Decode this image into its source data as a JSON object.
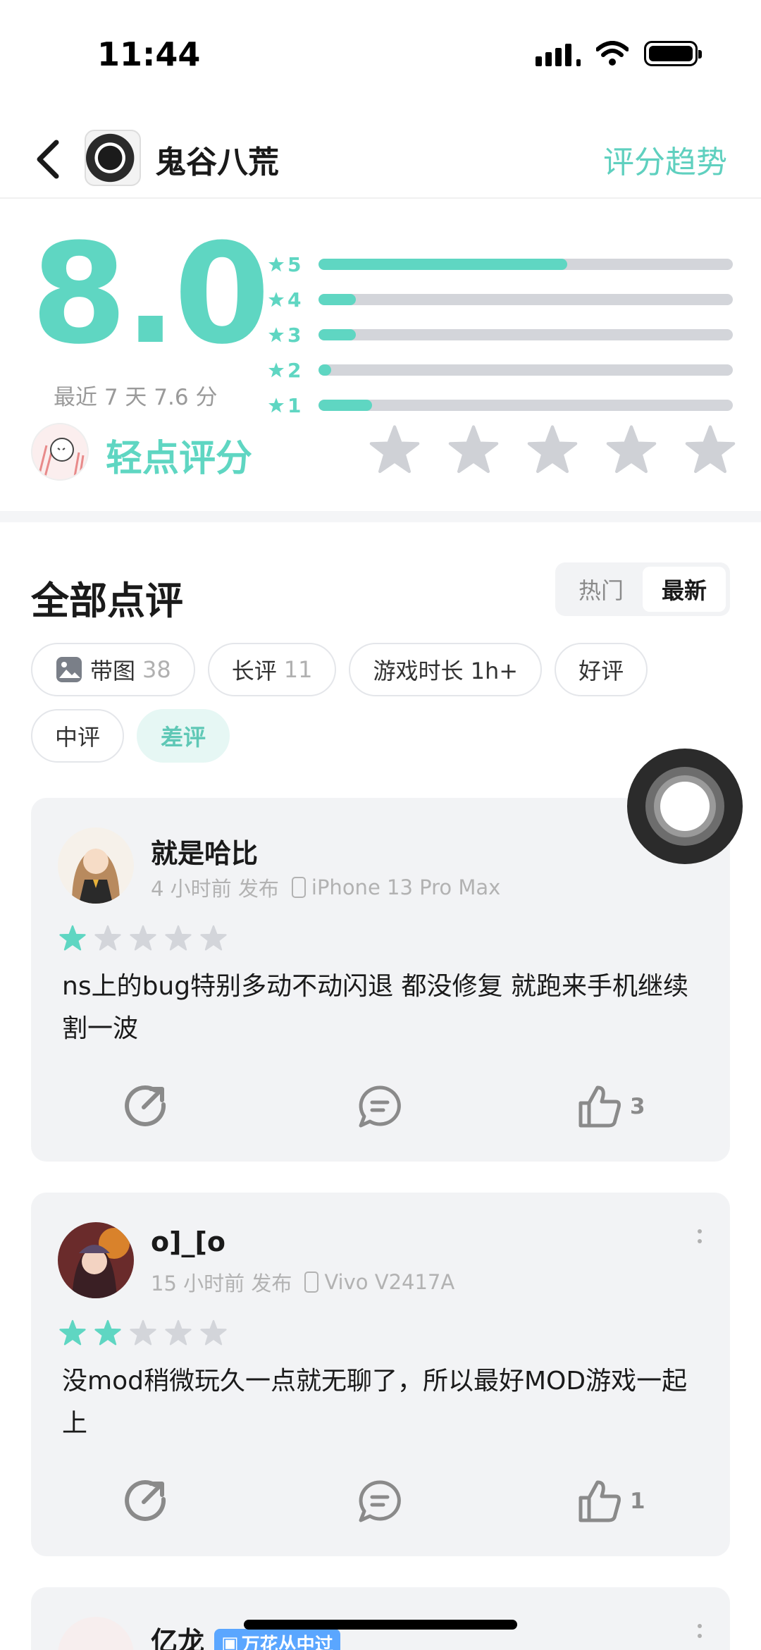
{
  "status_bar": {
    "time": "11:44"
  },
  "header": {
    "game_name": "鬼谷八荒",
    "trend_link": "评分趋势"
  },
  "rating": {
    "score": "8.0",
    "recent": "最近 7 天 7.6 分",
    "distribution": [
      {
        "star": "5",
        "fraction": 0.6
      },
      {
        "star": "4",
        "fraction": 0.09
      },
      {
        "star": "3",
        "fraction": 0.09
      },
      {
        "star": "2",
        "fraction": 0.03
      },
      {
        "star": "1",
        "fraction": 0.13
      }
    ],
    "tap_label": "轻点评分"
  },
  "reviews_section": {
    "title": "全部点评",
    "sort_options": [
      "热门",
      "最新"
    ],
    "active_sort": "最新",
    "filters": [
      {
        "label": "带图",
        "count": "38",
        "icon": "image-icon"
      },
      {
        "label": "长评",
        "count": "11"
      },
      {
        "label": "游戏时长 1h+",
        "count": ""
      },
      {
        "label": "好评",
        "count": ""
      },
      {
        "label": "中评",
        "count": ""
      },
      {
        "label": "差评",
        "count": "",
        "active": true
      }
    ]
  },
  "reviews": [
    {
      "username": "就是哈比",
      "time": "4 小时前 发布",
      "device": "iPhone 13 Pro Max",
      "stars": 1,
      "body": "ns上的bug特别多动不动闪退 都没修复 就跑来手机继续割一波",
      "likes": "3"
    },
    {
      "username": "o]_[o",
      "time": "15 小时前 发布",
      "device": "Vivo V2417A",
      "stars": 2,
      "body": "没mod稍微玩久一点就无聊了，所以最好MOD游戏一起上",
      "likes": "1"
    },
    {
      "username": "亿龙",
      "badge": "万花丛中过"
    }
  ],
  "colors": {
    "accent": "#5fd6c2",
    "card_bg": "#f2f3f5",
    "star_empty": "#d3d5da"
  }
}
